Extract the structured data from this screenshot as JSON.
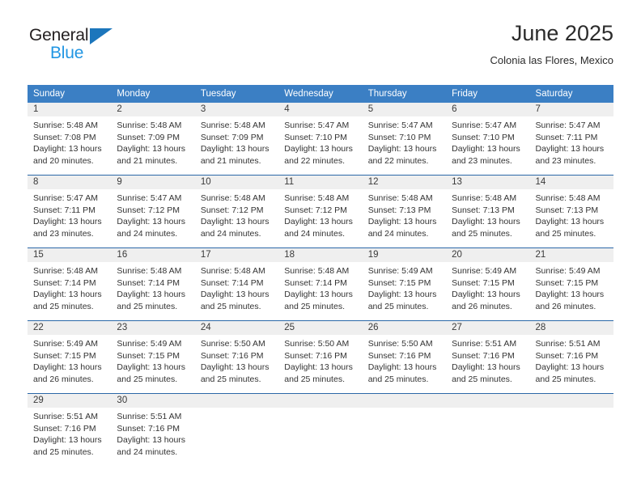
{
  "logo": {
    "word_top": "General",
    "word_bottom": "Blue",
    "triangle_color": "#1c76bc",
    "blue_color": "#2196e3"
  },
  "header": {
    "title": "June 2025",
    "location": "Colonia las Flores, Mexico"
  },
  "theme": {
    "header_bg": "#3b7fc4",
    "row_divider": "#2b68a8",
    "daynum_bg": "#efefef",
    "text": "#333333"
  },
  "weekdays": [
    "Sunday",
    "Monday",
    "Tuesday",
    "Wednesday",
    "Thursday",
    "Friday",
    "Saturday"
  ],
  "weeks": [
    [
      {
        "day": "1",
        "sunrise": "Sunrise: 5:48 AM",
        "sunset": "Sunset: 7:08 PM",
        "daylight1": "Daylight: 13 hours",
        "daylight2": "and 20 minutes."
      },
      {
        "day": "2",
        "sunrise": "Sunrise: 5:48 AM",
        "sunset": "Sunset: 7:09 PM",
        "daylight1": "Daylight: 13 hours",
        "daylight2": "and 21 minutes."
      },
      {
        "day": "3",
        "sunrise": "Sunrise: 5:48 AM",
        "sunset": "Sunset: 7:09 PM",
        "daylight1": "Daylight: 13 hours",
        "daylight2": "and 21 minutes."
      },
      {
        "day": "4",
        "sunrise": "Sunrise: 5:47 AM",
        "sunset": "Sunset: 7:10 PM",
        "daylight1": "Daylight: 13 hours",
        "daylight2": "and 22 minutes."
      },
      {
        "day": "5",
        "sunrise": "Sunrise: 5:47 AM",
        "sunset": "Sunset: 7:10 PM",
        "daylight1": "Daylight: 13 hours",
        "daylight2": "and 22 minutes."
      },
      {
        "day": "6",
        "sunrise": "Sunrise: 5:47 AM",
        "sunset": "Sunset: 7:10 PM",
        "daylight1": "Daylight: 13 hours",
        "daylight2": "and 23 minutes."
      },
      {
        "day": "7",
        "sunrise": "Sunrise: 5:47 AM",
        "sunset": "Sunset: 7:11 PM",
        "daylight1": "Daylight: 13 hours",
        "daylight2": "and 23 minutes."
      }
    ],
    [
      {
        "day": "8",
        "sunrise": "Sunrise: 5:47 AM",
        "sunset": "Sunset: 7:11 PM",
        "daylight1": "Daylight: 13 hours",
        "daylight2": "and 23 minutes."
      },
      {
        "day": "9",
        "sunrise": "Sunrise: 5:47 AM",
        "sunset": "Sunset: 7:12 PM",
        "daylight1": "Daylight: 13 hours",
        "daylight2": "and 24 minutes."
      },
      {
        "day": "10",
        "sunrise": "Sunrise: 5:48 AM",
        "sunset": "Sunset: 7:12 PM",
        "daylight1": "Daylight: 13 hours",
        "daylight2": "and 24 minutes."
      },
      {
        "day": "11",
        "sunrise": "Sunrise: 5:48 AM",
        "sunset": "Sunset: 7:12 PM",
        "daylight1": "Daylight: 13 hours",
        "daylight2": "and 24 minutes."
      },
      {
        "day": "12",
        "sunrise": "Sunrise: 5:48 AM",
        "sunset": "Sunset: 7:13 PM",
        "daylight1": "Daylight: 13 hours",
        "daylight2": "and 24 minutes."
      },
      {
        "day": "13",
        "sunrise": "Sunrise: 5:48 AM",
        "sunset": "Sunset: 7:13 PM",
        "daylight1": "Daylight: 13 hours",
        "daylight2": "and 25 minutes."
      },
      {
        "day": "14",
        "sunrise": "Sunrise: 5:48 AM",
        "sunset": "Sunset: 7:13 PM",
        "daylight1": "Daylight: 13 hours",
        "daylight2": "and 25 minutes."
      }
    ],
    [
      {
        "day": "15",
        "sunrise": "Sunrise: 5:48 AM",
        "sunset": "Sunset: 7:14 PM",
        "daylight1": "Daylight: 13 hours",
        "daylight2": "and 25 minutes."
      },
      {
        "day": "16",
        "sunrise": "Sunrise: 5:48 AM",
        "sunset": "Sunset: 7:14 PM",
        "daylight1": "Daylight: 13 hours",
        "daylight2": "and 25 minutes."
      },
      {
        "day": "17",
        "sunrise": "Sunrise: 5:48 AM",
        "sunset": "Sunset: 7:14 PM",
        "daylight1": "Daylight: 13 hours",
        "daylight2": "and 25 minutes."
      },
      {
        "day": "18",
        "sunrise": "Sunrise: 5:48 AM",
        "sunset": "Sunset: 7:14 PM",
        "daylight1": "Daylight: 13 hours",
        "daylight2": "and 25 minutes."
      },
      {
        "day": "19",
        "sunrise": "Sunrise: 5:49 AM",
        "sunset": "Sunset: 7:15 PM",
        "daylight1": "Daylight: 13 hours",
        "daylight2": "and 25 minutes."
      },
      {
        "day": "20",
        "sunrise": "Sunrise: 5:49 AM",
        "sunset": "Sunset: 7:15 PM",
        "daylight1": "Daylight: 13 hours",
        "daylight2": "and 26 minutes."
      },
      {
        "day": "21",
        "sunrise": "Sunrise: 5:49 AM",
        "sunset": "Sunset: 7:15 PM",
        "daylight1": "Daylight: 13 hours",
        "daylight2": "and 26 minutes."
      }
    ],
    [
      {
        "day": "22",
        "sunrise": "Sunrise: 5:49 AM",
        "sunset": "Sunset: 7:15 PM",
        "daylight1": "Daylight: 13 hours",
        "daylight2": "and 26 minutes."
      },
      {
        "day": "23",
        "sunrise": "Sunrise: 5:49 AM",
        "sunset": "Sunset: 7:15 PM",
        "daylight1": "Daylight: 13 hours",
        "daylight2": "and 25 minutes."
      },
      {
        "day": "24",
        "sunrise": "Sunrise: 5:50 AM",
        "sunset": "Sunset: 7:16 PM",
        "daylight1": "Daylight: 13 hours",
        "daylight2": "and 25 minutes."
      },
      {
        "day": "25",
        "sunrise": "Sunrise: 5:50 AM",
        "sunset": "Sunset: 7:16 PM",
        "daylight1": "Daylight: 13 hours",
        "daylight2": "and 25 minutes."
      },
      {
        "day": "26",
        "sunrise": "Sunrise: 5:50 AM",
        "sunset": "Sunset: 7:16 PM",
        "daylight1": "Daylight: 13 hours",
        "daylight2": "and 25 minutes."
      },
      {
        "day": "27",
        "sunrise": "Sunrise: 5:51 AM",
        "sunset": "Sunset: 7:16 PM",
        "daylight1": "Daylight: 13 hours",
        "daylight2": "and 25 minutes."
      },
      {
        "day": "28",
        "sunrise": "Sunrise: 5:51 AM",
        "sunset": "Sunset: 7:16 PM",
        "daylight1": "Daylight: 13 hours",
        "daylight2": "and 25 minutes."
      }
    ],
    [
      {
        "day": "29",
        "sunrise": "Sunrise: 5:51 AM",
        "sunset": "Sunset: 7:16 PM",
        "daylight1": "Daylight: 13 hours",
        "daylight2": "and 25 minutes."
      },
      {
        "day": "30",
        "sunrise": "Sunrise: 5:51 AM",
        "sunset": "Sunset: 7:16 PM",
        "daylight1": "Daylight: 13 hours",
        "daylight2": "and 24 minutes."
      },
      {
        "day": "",
        "sunrise": "",
        "sunset": "",
        "daylight1": "",
        "daylight2": ""
      },
      {
        "day": "",
        "sunrise": "",
        "sunset": "",
        "daylight1": "",
        "daylight2": ""
      },
      {
        "day": "",
        "sunrise": "",
        "sunset": "",
        "daylight1": "",
        "daylight2": ""
      },
      {
        "day": "",
        "sunrise": "",
        "sunset": "",
        "daylight1": "",
        "daylight2": ""
      },
      {
        "day": "",
        "sunrise": "",
        "sunset": "",
        "daylight1": "",
        "daylight2": ""
      }
    ]
  ]
}
